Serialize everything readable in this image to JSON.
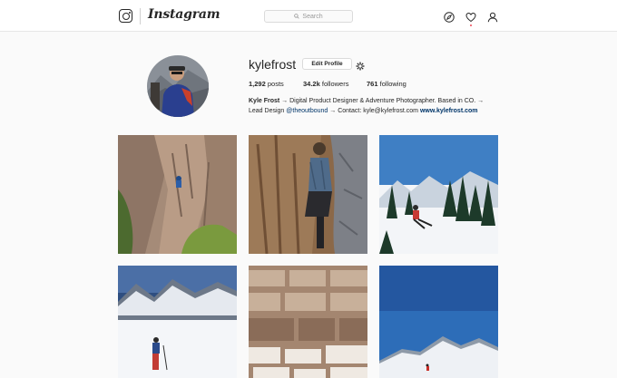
{
  "header": {
    "wordmark": "Instagram",
    "search_placeholder": "Search",
    "icons": [
      "explore-compass-icon",
      "activity-heart-icon",
      "profile-person-icon"
    ]
  },
  "profile": {
    "username": "kylefrost",
    "edit_label": "Edit Profile",
    "posts_count": "1,292",
    "posts_label": "posts",
    "followers_count": "34.2k",
    "followers_label": "followers",
    "following_count": "761",
    "following_label": "following",
    "bio": {
      "name": "Kyle Frost",
      "text1": " → Digital Product Designer & Adventure Photographer. Based in CO. →",
      "text2": "Lead Design ",
      "mention": "@theoutbound",
      "text3": " → Contact: kyle@kylefrost.com ",
      "url": "www.kylefrost.com"
    }
  },
  "posts": [
    "rock-climber-canyon-photo",
    "woman-climbing-boulder-photo",
    "skier-pine-forest-photo",
    "ski-tourer-mountains-photo",
    "salt-terraces-photo",
    "snowy-mountain-blue-sky-photo"
  ]
}
